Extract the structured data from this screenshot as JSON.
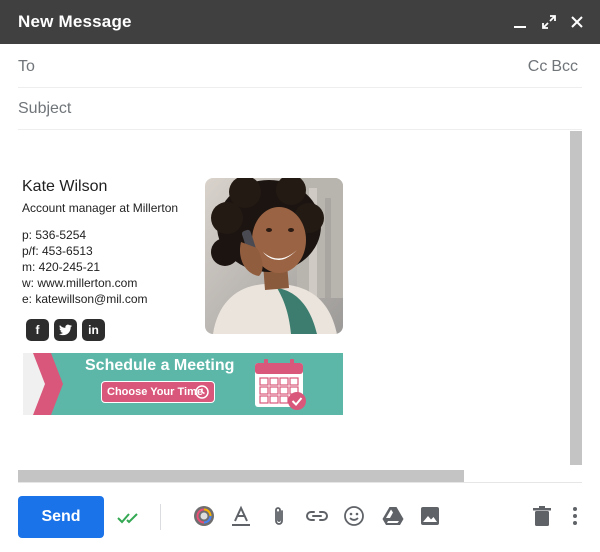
{
  "window": {
    "title": "New Message"
  },
  "fields": {
    "to_label": "To",
    "cc_label": "Cc",
    "bcc_label": "Bcc",
    "subject_label": "Subject"
  },
  "signature": {
    "name": "Kate Wilson",
    "title": "Account manager at  Millerton",
    "contacts": [
      "p: 536-5254",
      "p/f: 453-6513",
      "m: 420-245-21",
      "w: www.millerton.com",
      "e: katewillson@mil.com"
    ],
    "social": [
      {
        "name": "facebook-icon",
        "glyph": "f"
      },
      {
        "name": "twitter-icon",
        "glyph": ""
      },
      {
        "name": "linkedin-icon",
        "glyph": "in"
      }
    ]
  },
  "banner": {
    "title": "Schedule a Meeting",
    "button_label": "Choose Your Time",
    "bg_color": "#5db7a9",
    "accent_color": "#d9577a"
  },
  "toolbar": {
    "send_label": "Send",
    "send_color": "#1a73e8"
  }
}
